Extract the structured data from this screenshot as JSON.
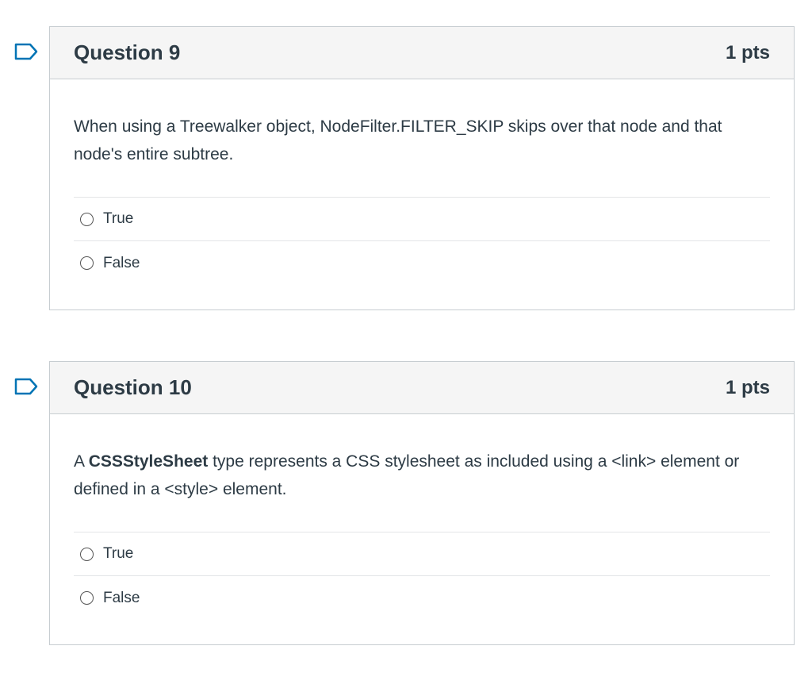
{
  "questions": [
    {
      "title": "Question 9",
      "points": "1 pts",
      "text_parts": {
        "before": "When using a Treewalker object, NodeFilter.FILTER_SKIP skips over that node and that node's entire subtree.",
        "bold": "",
        "after": ""
      },
      "answers": [
        {
          "label": "True",
          "selected": false
        },
        {
          "label": "False",
          "selected": false
        }
      ]
    },
    {
      "title": "Question 10",
      "points": "1 pts",
      "text_parts": {
        "before": "A ",
        "bold": "CSSStyleSheet",
        "after": " type represents a CSS stylesheet as included using a <link> element or defined in a <style> element."
      },
      "answers": [
        {
          "label": "True",
          "selected": false
        },
        {
          "label": "False",
          "selected": false
        }
      ]
    }
  ],
  "colors": {
    "border": "#c7cdd1",
    "header_bg": "#f5f5f5",
    "text": "#2d3b45",
    "flag": "#0374b5"
  },
  "icons": {
    "flag": "flag-outline-icon",
    "radio": "radio-unselected-icon"
  }
}
